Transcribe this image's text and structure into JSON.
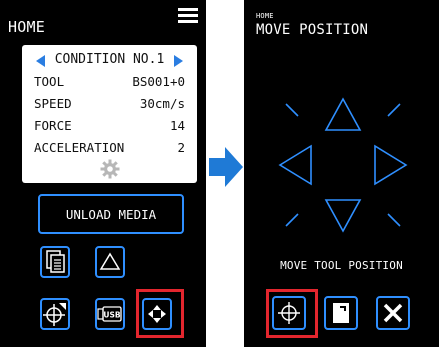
{
  "left": {
    "title": "HOME",
    "condition": {
      "header": "CONDITION NO.1",
      "rows": [
        {
          "key": "TOOL",
          "value": "BS001+0"
        },
        {
          "key": "SPEED",
          "value": "30cm/s"
        },
        {
          "key": "FORCE",
          "value": "14"
        },
        {
          "key": "ACCELERATION",
          "value": "2"
        }
      ]
    },
    "buttons": {
      "unload": "UNLOAD MEDIA",
      "usb": "USB"
    }
  },
  "right": {
    "breadcrumb": "HOME",
    "title": "MOVE POSITION",
    "caption": "MOVE TOOL POSITION"
  },
  "colors": {
    "accent": "#2f8fff",
    "highlight": "#e3262e",
    "screen_bg": "#000000",
    "arrow": "#1f7ad6"
  },
  "icons": [
    "hamburger-icon",
    "gear-icon",
    "copy-icon",
    "triangle-icon",
    "origin-crosshair-icon",
    "usb-icon",
    "move-arrows-icon",
    "direction-pad-icon",
    "menu-document-icon",
    "close-icon"
  ]
}
